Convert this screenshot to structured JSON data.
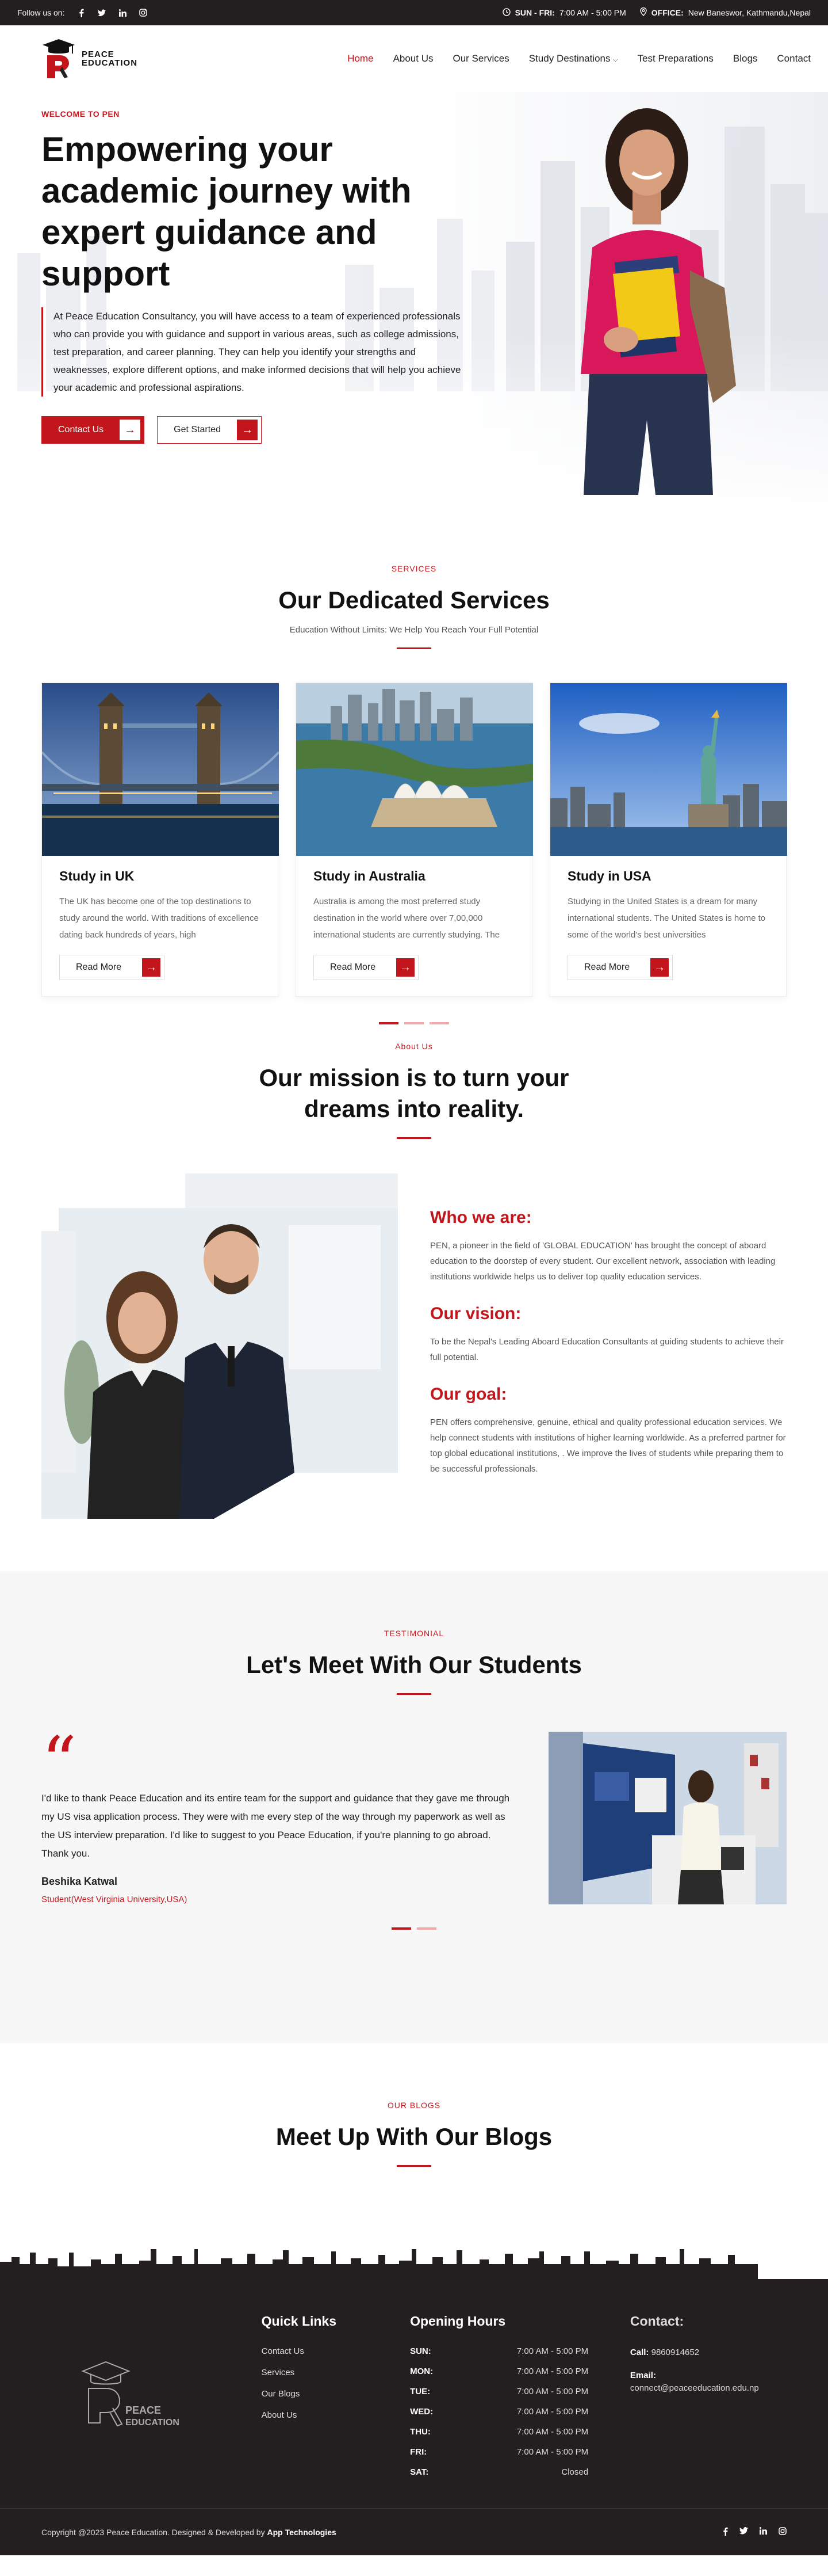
{
  "topbar": {
    "follow_label": "Follow us on:",
    "social_icons": [
      "facebook-icon",
      "twitter-icon",
      "linkedin-icon",
      "instagram-icon"
    ],
    "hours_label": "SUN - FRI:",
    "hours_value": "7:00 AM - 5:00 PM",
    "office_label": "OFFICE:",
    "office_value": "New Baneswor, Kathmandu,Nepal"
  },
  "brand": {
    "logo_line1": "PEACE",
    "logo_line2": "EDUCATION",
    "accent": "#c3161c",
    "dark": "#231f20"
  },
  "nav": {
    "items": [
      {
        "label": "Home",
        "active": true
      },
      {
        "label": "About Us"
      },
      {
        "label": "Our Services"
      },
      {
        "label": "Study Destinations"
      },
      {
        "label": "Test Preparations"
      },
      {
        "label": "Blogs"
      },
      {
        "label": "Contact"
      }
    ]
  },
  "hero": {
    "eyebrow": "WELCOME TO PEN",
    "title": "Empowering your academic journey with expert guidance and support",
    "lead": "At Peace Education Consultancy, you will have access to a team of experienced professionals who can provide you with guidance and support in various areas, such as college admissions, test preparation, and career planning. They can help you identify your strengths and weaknesses, explore different options, and make informed decisions that will help you achieve your academic and professional aspirations.",
    "btn_contact": "Contact Us",
    "btn_start": "Get Started"
  },
  "services": {
    "tag": "SERVICES",
    "title": "Our Dedicated Services",
    "subtitle": "Education Without Limits: We Help You Reach Your Full Potential",
    "cards": [
      {
        "title": "Study in UK",
        "text": "The UK has become one of the top destinations to study around the world. With traditions of excellence dating back hundreds of years, high",
        "button": "Read More"
      },
      {
        "title": "Study in Australia",
        "text": "Australia is among the most preferred study destination in the world where over 7,00,000 international students are currently studying. The",
        "button": "Read More"
      },
      {
        "title": "Study in USA",
        "text": "Studying in the United States is a dream for many international students. The United States is home to some of the world's best universities",
        "button": "Read More"
      }
    ]
  },
  "about": {
    "tag": "About Us",
    "title_line1": "Our mission is to turn your",
    "title_line2": "dreams into reality.",
    "who_title": "Who we are:",
    "who_text": "PEN, a pioneer in the field of 'GLOBAL EDUCATION' has brought the concept of aboard education to the doorstep of every student. Our excellent network, association with leading institutions worldwide helps us to deliver top quality education services.",
    "vision_title": "Our vision:",
    "vision_text": "To be the Nepal's Leading Aboard Education Consultants at guiding students to achieve their full potential.",
    "goal_title": "Our goal:",
    "goal_text": "PEN offers comprehensive, genuine, ethical and quality professional education services. We help connect students with institutions of higher learning worldwide. As a preferred partner for top global educational institutions, . We improve the lives of students while preparing them to be successful professionals."
  },
  "testimonial": {
    "tag": "TESTIMONIAL",
    "title": "Let's Meet With Our Students",
    "message": "I'd like to thank Peace Education and its entire team for the support and guidance that they gave me through my US visa application process. They were with me every step of the way through my paperwork as well as the US interview preparation. I'd like to suggest to you Peace Education, if you're planning to go abroad. Thank you.",
    "name": "Beshika Katwal",
    "role": "Student(West Virginia University,USA)"
  },
  "blogs": {
    "tag": "OUR BLOGS",
    "title": "Meet Up With Our Blogs"
  },
  "footer": {
    "quick_links_title": "Quick Links",
    "quick_links": [
      "Contact Us",
      "Services",
      "Our Blogs",
      "About Us"
    ],
    "hours_title": "Opening Hours",
    "hours": [
      {
        "day": "SUN:",
        "time": "7:00 AM - 5:00 PM"
      },
      {
        "day": "MON:",
        "time": "7:00 AM - 5:00 PM"
      },
      {
        "day": "TUE:",
        "time": "7:00 AM - 5:00 PM"
      },
      {
        "day": "WED:",
        "time": "7:00 AM - 5:00 PM"
      },
      {
        "day": "THU:",
        "time": "7:00 AM - 5:00 PM"
      },
      {
        "day": "FRI:",
        "time": "7:00 AM - 5:00 PM"
      },
      {
        "day": "SAT:",
        "time": "Closed"
      }
    ],
    "contact_title": "Contact:",
    "call_label": "Call:",
    "call_value": "9860914652",
    "email_label": "Email:",
    "email_value": "connect@peaceeducation.edu.np",
    "copyright": "Copyright @2023 Peace Education. Designed & Developed by",
    "developer": "App Technologies"
  }
}
